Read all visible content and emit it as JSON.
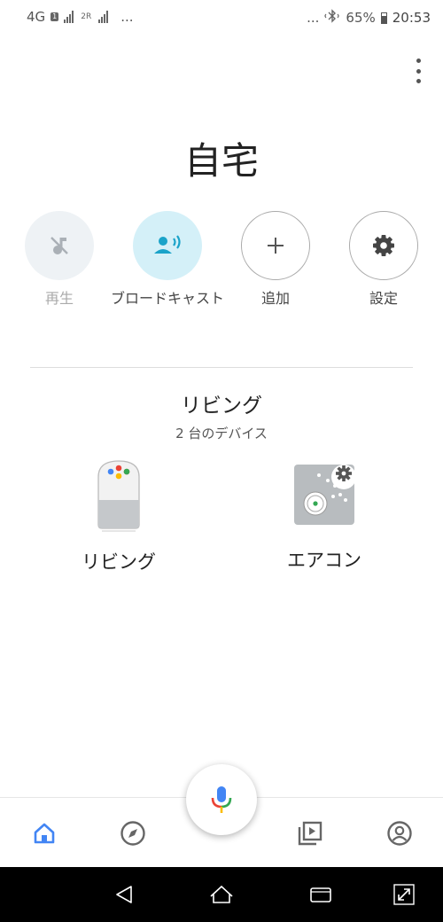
{
  "status_bar": {
    "network": "4G",
    "sim1": "1",
    "sim2": "2R",
    "left_more": "...",
    "right_more": "...",
    "battery": "65%",
    "time": "20:53"
  },
  "home": {
    "title": "自宅"
  },
  "actions": [
    {
      "label": "再生",
      "icon": "music-off-icon"
    },
    {
      "label": "ブロードキャスト",
      "icon": "broadcast-icon"
    },
    {
      "label": "追加",
      "icon": "plus-icon"
    },
    {
      "label": "設定",
      "icon": "gear-icon"
    }
  ],
  "room": {
    "name": "リビング",
    "device_count": "2 台のデバイス",
    "devices": [
      {
        "label": "リビング",
        "icon": "google-home-speaker-icon"
      },
      {
        "label": "エアコン",
        "icon": "remote-control-device-icon"
      }
    ]
  },
  "bottom_nav": [
    "home-icon",
    "discover-compass-icon",
    "media-icon",
    "account-icon"
  ],
  "colors": {
    "accent_blue": "#4285F4",
    "broadcast_teal": "#1AA3C9",
    "broadcast_bg": "#D4F0F8",
    "google_red": "#EA4335",
    "google_yellow": "#FBBC05",
    "google_green": "#34A853"
  }
}
